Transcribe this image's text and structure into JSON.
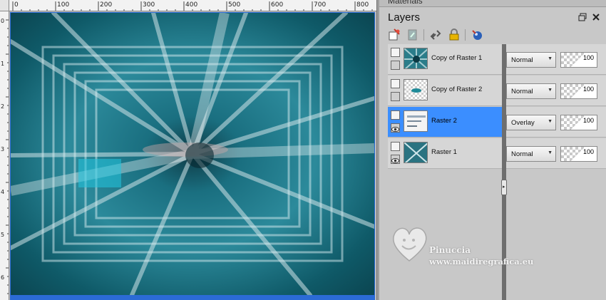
{
  "materials_panel": {
    "title": "Materials"
  },
  "layers_panel": {
    "title": "Layers",
    "header_buttons": [
      "restore-icon",
      "close-icon"
    ],
    "toolbar_icons": [
      "new-layer-icon",
      "duplicate-layer-icon",
      "link-icon",
      "lock-icon",
      "mask-icon"
    ],
    "layers": [
      {
        "name": "Copy of Raster 1",
        "blend_mode": "Normal",
        "opacity": "100",
        "selected": false,
        "visible": true
      },
      {
        "name": "Copy of Raster 2",
        "blend_mode": "Normal",
        "opacity": "100",
        "selected": false,
        "visible": true
      },
      {
        "name": "Raster 2",
        "blend_mode": "Overlay",
        "opacity": "100",
        "selected": true,
        "visible": true
      },
      {
        "name": "Raster 1",
        "blend_mode": "Normal",
        "opacity": "100",
        "selected": false,
        "visible": true
      }
    ]
  },
  "ruler": {
    "top_labels": [
      "0",
      "100",
      "200",
      "300",
      "400",
      "500",
      "600",
      "700",
      "800"
    ],
    "left_labels": [
      "0",
      "1",
      "2",
      "3",
      "4",
      "5",
      "6"
    ]
  },
  "watermark": {
    "line1": "Pinuccia",
    "line2": "www.maidiregrafica.eu"
  },
  "colors": {
    "selected_row": "#3b8eff",
    "canvas_border": "#2b6bd6",
    "panel_bg": "#c8c8c8"
  }
}
